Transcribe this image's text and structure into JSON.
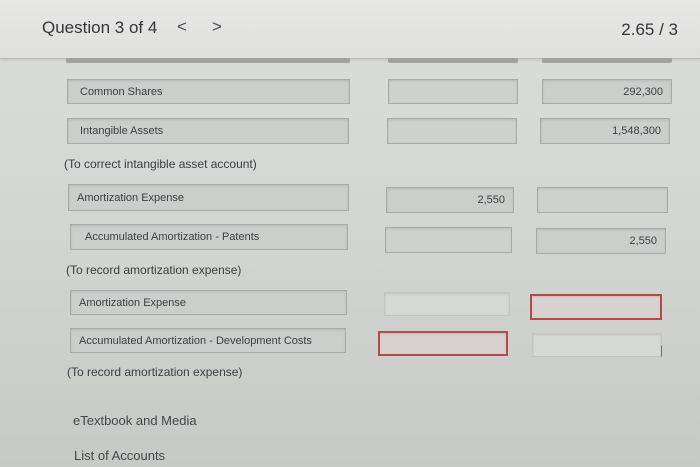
{
  "header": {
    "question_label": "Question 3 of 4",
    "prev_glyph": "<",
    "next_glyph": ">",
    "score": "2.65 / 3"
  },
  "entries": [
    {
      "account": "Common Shares",
      "debit": "",
      "credit": "292,300"
    },
    {
      "account": "Intangible Assets",
      "debit": "",
      "credit": "1,548,300"
    },
    {
      "account": "Amortization Expense",
      "debit": "2,550",
      "credit": ""
    },
    {
      "account": "Accumulated Amortization - Patents",
      "debit": "",
      "credit": "2,550"
    },
    {
      "account": "Amortization Expense",
      "debit": "",
      "credit": ""
    },
    {
      "account": "Accumulated Amortization - Development Costs",
      "debit": "",
      "credit": ""
    }
  ],
  "notes": {
    "correct_intangible": "(To correct intangible asset account)",
    "record_amortization_1": "(To record amortization expense)",
    "record_amortization_2": "(To record amortization expense)"
  },
  "links": {
    "etextbook": "eTextbook and Media",
    "list_of_accounts": "List of Accounts"
  },
  "colors": {
    "error_border": "#b74a46",
    "field_bg": "#cbcecb"
  }
}
